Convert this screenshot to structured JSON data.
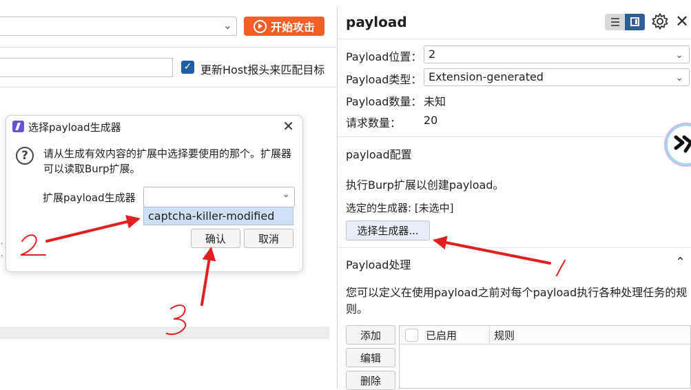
{
  "left": {
    "start_attack_label": "开始攻击",
    "update_host_label": "更新Host报头来匹配目标",
    "update_host_checked": true
  },
  "right": {
    "title": "payload",
    "rows": {
      "position_label": "Payload位置：",
      "position_value": "2",
      "type_label": "Payload类型：",
      "type_value": "Extension-generated",
      "count_label": "Payload数量：",
      "count_value": "未知",
      "requests_label": "请求数量：",
      "requests_value": "20"
    },
    "config": {
      "heading": "payload配置",
      "desc": "执行Burp扩展以创建payload。",
      "selected": "选定的生成器: [未选中]",
      "choose_button": "选择生成器..."
    },
    "processing": {
      "heading": "Payload处理",
      "desc": "您可以定义在使用payload之前对每个payload执行各种处理任务的规则。",
      "buttons": [
        "添加",
        "编辑",
        "删除"
      ],
      "table_headers": [
        "已启用",
        "规则"
      ]
    }
  },
  "dialog": {
    "title": "选择payload生成器",
    "message": "请从生成有效内容的扩展中选择要使用的那个。扩展器可以读取Burp扩展。",
    "field_label": "扩展payload生成器",
    "option": "captcha-killer-modified",
    "ok_label": "确认",
    "cancel_label": "取消"
  },
  "colors": {
    "attack_button": "#f25f24",
    "annotation": "#e02020",
    "toggle_active": "#2e5f94",
    "option_highlight": "#cfe0f5"
  },
  "icons": [
    "play-icon",
    "checkbox-checked-icon",
    "list-view-icon",
    "panel-view-icon",
    "gear-icon",
    "close-icon",
    "question-icon",
    "chevron-down-icon",
    "chevron-up-icon",
    "burp-extension-icon"
  ],
  "annotations": {
    "number_1": "1",
    "number_2": "2",
    "number_3": "3"
  }
}
